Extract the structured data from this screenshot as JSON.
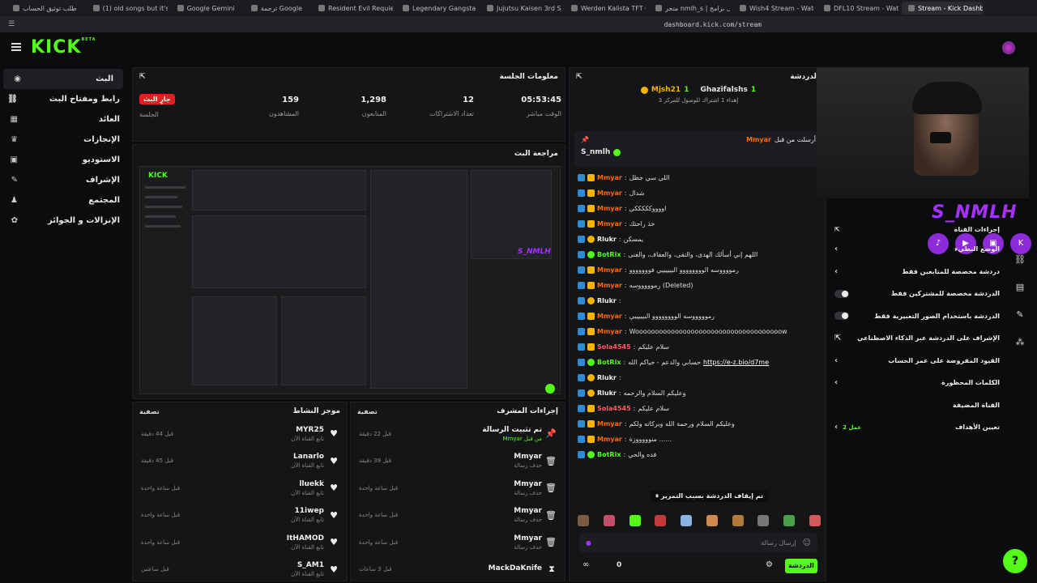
{
  "browser": {
    "tabs": [
      "طلب توثيق الحساب",
      "(1) old songs but it's lofi re",
      "Google Gemini",
      "ترجمة Google",
      "Resident Evil Requiem - C",
      "Legendary Gangsta Rap fro",
      "Jujutsu Kaisen 3rd Season",
      "Werden Kalista TFT Comp",
      "متجر nmlh_s | أفضل برامج",
      "Wish4 Stream - Watch",
      "DFL10 Stream - Watch",
      "Stream - Kick Dashb"
    ],
    "url": "dashboard.kick.com/stream"
  },
  "logo": {
    "text": "KICK",
    "beta": "BETA"
  },
  "sidebar": {
    "items": [
      {
        "label": "البث",
        "icon": "broadcast-icon"
      },
      {
        "label": "رابط ومفتاح البث",
        "icon": "link-icon"
      },
      {
        "label": "العائد",
        "icon": "grid-icon"
      },
      {
        "label": "الإنجازات",
        "icon": "trophy-icon"
      },
      {
        "label": "الاستوديو",
        "icon": "studio-icon"
      },
      {
        "label": "الإشراف",
        "icon": "wrench-icon"
      },
      {
        "label": "المجتمع",
        "icon": "community-icon"
      },
      {
        "label": "الإنزالات و الجوائز",
        "icon": "gift-icon"
      }
    ]
  },
  "session": {
    "title": "معلومات الجلسة",
    "live_label": "جارٍ البث",
    "session_label": "الجلسة",
    "stats": [
      {
        "value": "159",
        "label": "المشاهدون"
      },
      {
        "value": "1,298",
        "label": "المتابعون"
      },
      {
        "value": "12",
        "label": "تعداد الاشتراكات"
      },
      {
        "value": "05:53:45",
        "label": "الوقت مباشر"
      }
    ]
  },
  "preview": {
    "title": "مراجعة البث",
    "overlay_name": "S_NMLH"
  },
  "activity": {
    "title": "موجز النشاط",
    "filter": "تصفية",
    "rows": [
      {
        "name": "MYR25",
        "sub": "تابع القناة الآن",
        "time": "قبل 44 دقيقة"
      },
      {
        "name": "Lanarlo",
        "sub": "تابع القناة الآن",
        "time": "قبل 45 دقيقة"
      },
      {
        "name": "lluekk",
        "sub": "تابع القناة الآن",
        "time": "قبل ساعة واحدة"
      },
      {
        "name": "11iwep",
        "sub": "تابع القناة الآن",
        "time": "قبل ساعة واحدة"
      },
      {
        "name": "ItHAMOD",
        "sub": "تابع القناة الآن",
        "time": "قبل ساعة واحدة"
      },
      {
        "name": "S_AM1",
        "sub": "تابع القناة الآن",
        "time": "قبل ساعتين"
      }
    ]
  },
  "modactions": {
    "title": "إجراءات المشرف",
    "filter": "تصفية",
    "rows": [
      {
        "icon": "pin-icon",
        "name": "تم تثبيت الرسالة",
        "sub": "من قبل Mmyar",
        "time": "قبل 22 دقيقة"
      },
      {
        "icon": "trash-icon",
        "name": "Mmyar",
        "sub": "حذف رسالة",
        "time": "قبل 39 دقيقة"
      },
      {
        "icon": "trash-icon",
        "name": "Mmyar",
        "sub": "حذف رسالة",
        "time": "قبل ساعة واحدة"
      },
      {
        "icon": "trash-icon",
        "name": "Mmyar",
        "sub": "حذف رسالة",
        "time": "قبل ساعة واحدة"
      },
      {
        "icon": "trash-icon",
        "name": "Mmyar",
        "sub": "حذف رسالة",
        "time": "قبل ساعة واحدة"
      },
      {
        "icon": "timeout-icon",
        "name": "MackDaKnife",
        "sub": "",
        "time": "قبل 3 ساعات"
      }
    ]
  },
  "chat": {
    "title": "الدردشة",
    "top_supporter": "Mjsh21",
    "top_supporter_count": "1",
    "gift_user": "Ghazifalshs",
    "gift_count": "1",
    "gift_note": "إهداء 1 اشتراك للوصول للمركز 3",
    "pinned_label": "أرسلت من قبل",
    "pinned_by": "Mmyar",
    "pinned_user": "S_nmlh",
    "messages": [
      {
        "user": "Mmyar",
        "color": "orange",
        "text": "اللي سي جطل"
      },
      {
        "user": "Mmyar",
        "color": "orange",
        "text": "شدال"
      },
      {
        "user": "Mmyar",
        "color": "orange",
        "text": "اووووكككككي"
      },
      {
        "user": "Mmyar",
        "color": "orange",
        "text": "خذ راحتك"
      },
      {
        "user": "Rlukr",
        "color": "white",
        "text": "يمسكن"
      },
      {
        "user": "BotRix",
        "color": "green",
        "text": "اللهم إني أسألك الهدى، والتقى، والعفاف، والغنى"
      },
      {
        "user": "Mmyar",
        "color": "orange",
        "text": "رمووووسه الوووووووو البيييييي فووووووو"
      },
      {
        "user": "Mmyar",
        "color": "orange",
        "text": "رموووووسه (Deleted)"
      },
      {
        "user": "Rlukr",
        "color": "white",
        "text": ""
      },
      {
        "user": "Mmyar",
        "color": "orange",
        "text": "رموووووسه الوووووووو البيييييي"
      },
      {
        "user": "Mmyar",
        "color": "orange",
        "text": "Wooooooooooooooooooooooooooooooooooooow"
      },
      {
        "user": "Sola4545",
        "color": "red",
        "text": "سلام عليكم"
      },
      {
        "user": "BotRix",
        "color": "green",
        "text": "حسابي والدعم - حياكم الله",
        "link": "https://e-z.bio/d7me"
      },
      {
        "user": "Rlukr",
        "color": "white",
        "text": ""
      },
      {
        "user": "Rlukr",
        "color": "white",
        "text": "وعليكم السلام والرحمه"
      },
      {
        "user": "Sola4545",
        "color": "red",
        "text": "سلام عليكم"
      },
      {
        "user": "Mmyar",
        "color": "orange",
        "text": "وعليكم السلام ورحمة الله وبركاته ولكم"
      },
      {
        "user": "Mmyar",
        "color": "orange",
        "text": "منوووووزة ......"
      },
      {
        "user": "BotRix",
        "color": "green",
        "text": "فده والحي"
      }
    ],
    "paused_label": "تم إيقاف الدردشة بسبب التمرير",
    "input_placeholder": "إرسال رسالة",
    "send_label": "الدردشة",
    "viewer_count": "0"
  },
  "brand_overlay": {
    "name": "S_NMLH"
  },
  "channel_actions": {
    "title": "إجراءات القناة",
    "rows": [
      {
        "label": "الوضع البطيء",
        "control": "chevron"
      },
      {
        "label": "دردشة مخصصة للمتابعين فقط",
        "control": "chevron"
      },
      {
        "label": "الدردشة مخصصة للمشتركين فقط",
        "control": "toggle"
      },
      {
        "label": "الدردشة باستخدام الصور التعبيرية فقط",
        "control": "toggle"
      },
      {
        "label": "الإشراف على الدردشة عبر الذكاء الاصطناعي",
        "control": "link"
      },
      {
        "label": "القيود المفروضة على عمر الحساب",
        "control": "chevron"
      },
      {
        "label": "الكلمات المحظورة",
        "control": "chevron"
      },
      {
        "label": "القناة المضيفة",
        "control": "none"
      },
      {
        "label": "تعيين الأهداف",
        "control": "chevron",
        "note": "عمل 2"
      }
    ]
  },
  "colors": {
    "brand": "#53fc18",
    "live": "#e01f1f",
    "accent": "#a530ff"
  }
}
